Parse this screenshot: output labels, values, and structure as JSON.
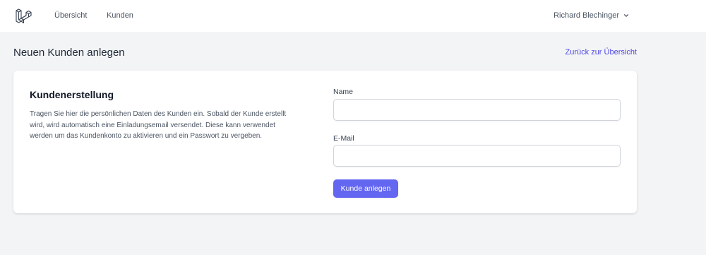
{
  "navbar": {
    "logo_icon": "laravel-logo-icon",
    "links": [
      {
        "label": "Übersicht"
      },
      {
        "label": "Kunden"
      }
    ],
    "user": {
      "name": "Richard Blechinger",
      "icon": "chevron-down-icon"
    }
  },
  "header": {
    "title": "Neuen Kunden anlegen",
    "back_link": "Zurück zur Übersicht"
  },
  "form": {
    "section_title": "Kundenerstellung",
    "section_description": "Tragen Sie hier die persönlichen Daten des Kunden ein. Sobald der Kunde erstellt wird, wird automatisch eine Einladungsemail versendet. Diese kann verwendet werden um das Kundenkonto zu aktivieren und ein Passwort zu vergeben.",
    "fields": [
      {
        "label": "Name",
        "value": "",
        "placeholder": ""
      },
      {
        "label": "E-Mail",
        "value": "",
        "placeholder": ""
      }
    ],
    "submit_label": "Kunde anlegen"
  },
  "colors": {
    "accent": "#6366f1",
    "link": "#4f46e5",
    "background": "#f3f4f6"
  }
}
